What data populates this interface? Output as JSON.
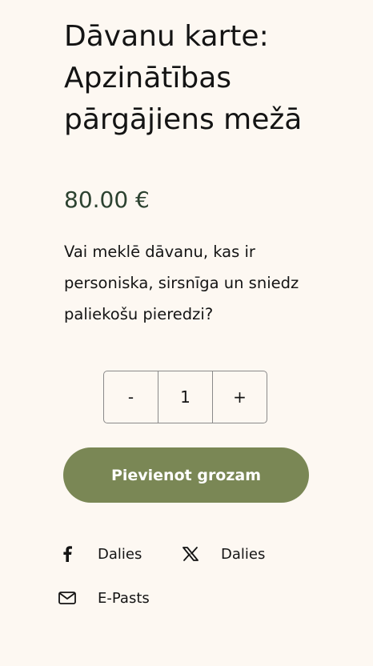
{
  "product": {
    "title": "Dāvanu karte: Apzinātības pārgājiens mežā",
    "price": "80.00 €",
    "description": "Vai meklē dāvanu, kas ir personiska, sirsnīga un sniedz paliekošu pieredzi?"
  },
  "quantity": {
    "decrement_label": "-",
    "value": "1",
    "increment_label": "+"
  },
  "cart": {
    "add_label": "Pievienot grozam"
  },
  "share": {
    "items": [
      {
        "icon": "facebook-icon",
        "label": "Dalies"
      },
      {
        "icon": "x-icon",
        "label": "Dalies"
      },
      {
        "icon": "envelope-icon",
        "label": "E-Pasts"
      }
    ]
  },
  "colors": {
    "background": "#fdf8f2",
    "price": "#2c4230",
    "button": "#7a8755",
    "button_text": "#ffffff",
    "text": "#141414"
  }
}
